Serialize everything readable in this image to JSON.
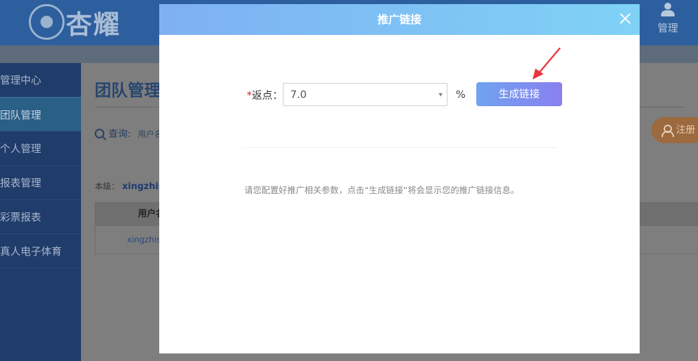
{
  "app": {
    "logo_text": "杏耀",
    "top_manage_label": "管理"
  },
  "sidebar": {
    "items": [
      {
        "label": "管理中心"
      },
      {
        "label": "团队管理"
      },
      {
        "label": "个人管理"
      },
      {
        "label": "报表管理"
      },
      {
        "label": "彩票报表"
      },
      {
        "label": "真人电子体育"
      }
    ]
  },
  "main": {
    "page_title": "团队管理",
    "query_label": "查询:",
    "query_user_label": "用户名",
    "level_label": "本级：",
    "level_value": "xingzhis",
    "table_header": "用户名",
    "table_row_user": "xingzhis",
    "register_button": "注册"
  },
  "modal": {
    "title": "推广链接",
    "rebate_required_mark": "*",
    "rebate_label": "返点：",
    "rebate_value": "7.0",
    "percent_sign": "%",
    "generate_button": "生成链接",
    "hint": "请您配置好推广相关参数，点击“生成链接”将会显示您的推广链接信息。"
  },
  "colors": {
    "modal_header_start": "#7eb0f2",
    "modal_header_end": "#7fd2f6",
    "generate_button_start": "#6fa3f0",
    "generate_button_end": "#8a7ff0",
    "annotation_arrow": "#e8383d"
  }
}
